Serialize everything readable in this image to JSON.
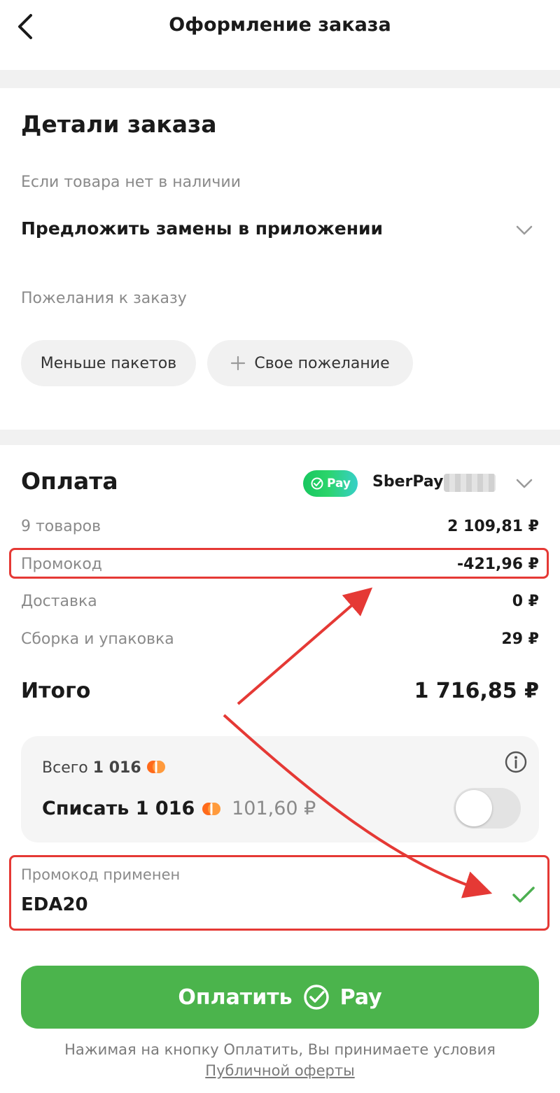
{
  "header": {
    "title": "Оформление заказа",
    "back_icon": "chevron-left-icon"
  },
  "order_details": {
    "title": "Детали заказа",
    "out_of_stock_label": "Если товара нет в наличии",
    "out_of_stock_value": "Предложить замены в приложении",
    "wishes_label": "Пожелания к заказу",
    "chips": [
      "Меньше пакетов",
      "Свое пожелание"
    ]
  },
  "payment": {
    "title": "Оплата",
    "method_badge": "Pay",
    "method_name": "SberPay",
    "rows": [
      {
        "label": "9 товаров",
        "value": "2 109,81 ₽"
      },
      {
        "label": "Промокод",
        "value": "-421,96 ₽"
      },
      {
        "label": "Доставка",
        "value": "0 ₽"
      },
      {
        "label": "Сборка и упаковка",
        "value": "29 ₽"
      }
    ],
    "total_label": "Итого",
    "total_value": "1 716,85 ₽"
  },
  "bonus": {
    "total_prefix": "Всего",
    "total_amount": "1 016",
    "spend_prefix": "Списать",
    "spend_amount": "1 016",
    "spend_rub": "101,60 ₽",
    "toggle_on": false
  },
  "promo": {
    "label": "Промокод применен",
    "code": "EDA20"
  },
  "pay_button": {
    "label": "Оплатить",
    "suffix": "Pay"
  },
  "footer": {
    "line1": "Нажимая на кнопку Оплатить, Вы принимаете условия",
    "link": "Публичной оферты"
  },
  "colors": {
    "accent_green": "#4bb44c",
    "highlight_red": "#e53935",
    "check_green": "#4caf50",
    "bonus_orange": "#ff6a1a"
  }
}
